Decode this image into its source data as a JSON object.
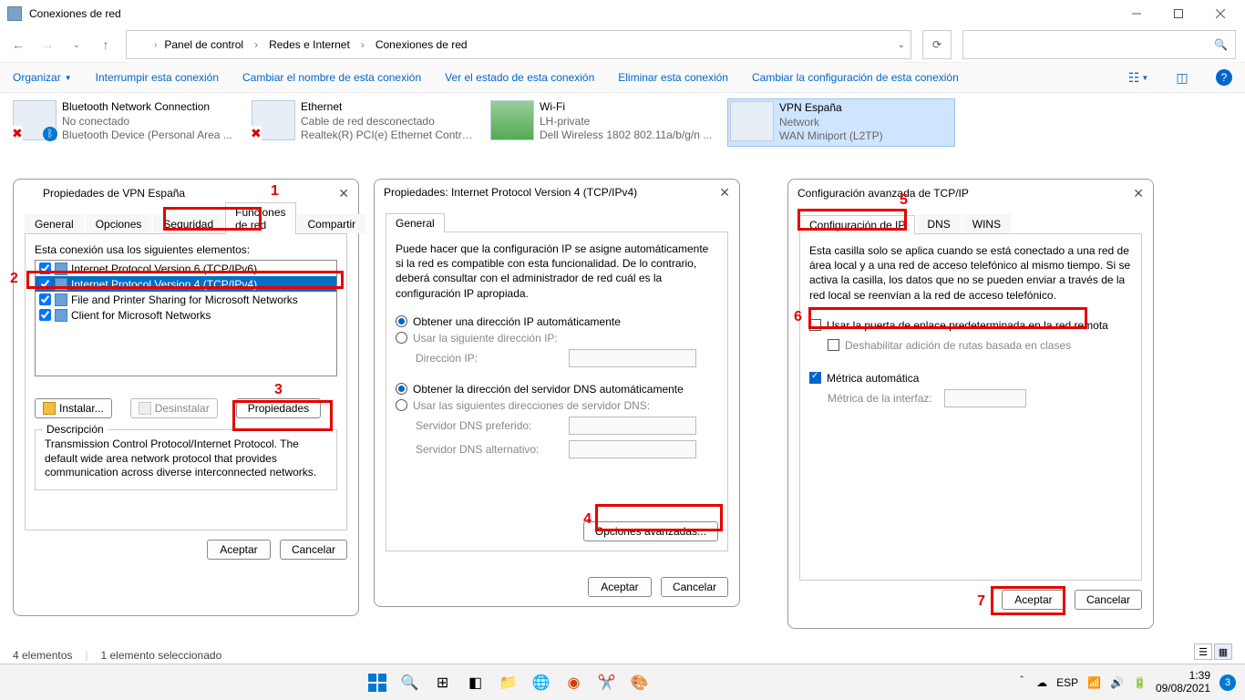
{
  "window": {
    "title": "Conexiones de red"
  },
  "breadcrumbs": {
    "c0": "Panel de control",
    "c1": "Redes e Internet",
    "c2": "Conexiones de red"
  },
  "cmdbar": {
    "organizar": "Organizar",
    "interrumpir": "Interrumpir esta conexión",
    "renombrar": "Cambiar el nombre de esta conexión",
    "ver_estado": "Ver el estado de esta conexión",
    "eliminar": "Eliminar esta conexión",
    "cambiar_config": "Cambiar la configuración de esta conexión"
  },
  "connections": [
    {
      "name": "Bluetooth Network Connection",
      "status": "No conectado",
      "device": "Bluetooth Device (Personal Area ..."
    },
    {
      "name": "Ethernet",
      "status": "Cable de red desconectado",
      "device": "Realtek(R) PCI(e) Ethernet Control..."
    },
    {
      "name": "Wi-Fi",
      "status": "LH-private",
      "device": "Dell Wireless 1802 802.11a/b/g/n ..."
    },
    {
      "name": "VPN España",
      "status": "Network",
      "device": "WAN Miniport (L2TP)"
    }
  ],
  "dlg1": {
    "title": "Propiedades de VPN España",
    "tabs": {
      "general": "General",
      "opciones": "Opciones",
      "seguridad": "Seguridad",
      "funciones": "Funciones de red",
      "compartir": "Compartir"
    },
    "label": "Esta conexión usa los siguientes elementos:",
    "items": {
      "ipv6": "Internet Protocol Version 6 (TCP/IPv6)",
      "ipv4": "Internet Protocol Version 4 (TCP/IPv4)",
      "fileprint": "File and Printer Sharing for Microsoft Networks",
      "client": "Client for Microsoft Networks"
    },
    "btn_instalar": "Instalar...",
    "btn_desinstalar": "Desinstalar",
    "btn_propiedades": "Propiedades",
    "desc_label": "Descripción",
    "desc": "Transmission Control Protocol/Internet Protocol. The default wide area network protocol that provides communication across diverse interconnected networks.",
    "aceptar": "Aceptar",
    "cancelar": "Cancelar"
  },
  "dlg2": {
    "title": "Propiedades: Internet Protocol Version 4 (TCP/IPv4)",
    "tab_general": "General",
    "intro": "Puede hacer que la configuración IP se asigne automáticamente si la red es compatible con esta funcionalidad. De lo contrario, deberá consultar con el administrador de red cuál es la configuración IP apropiada.",
    "r_auto_ip": "Obtener una dirección IP automáticamente",
    "r_manual_ip": "Usar la siguiente dirección IP:",
    "lbl_ip": "Dirección IP:",
    "r_auto_dns": "Obtener la dirección del servidor DNS automáticamente",
    "r_manual_dns": "Usar las siguientes direcciones de servidor DNS:",
    "lbl_dns1": "Servidor DNS preferido:",
    "lbl_dns2": "Servidor DNS alternativo:",
    "btn_avanzadas": "Opciones avanzadas...",
    "aceptar": "Aceptar",
    "cancelar": "Cancelar"
  },
  "dlg3": {
    "title": "Configuración avanzada de TCP/IP",
    "tabs": {
      "ip": "Configuración de IP",
      "dns": "DNS",
      "wins": "WINS"
    },
    "intro": "Esta casilla solo se aplica cuando se está conectado a una red de área local y a una red de acceso telefónico al mismo tiempo. Si se activa la casilla, los datos que no se pueden enviar a través de la red local se reenvían a la red de acceso telefónico.",
    "chk_gateway": "Usar la puerta de enlace predeterminada en la red remota",
    "chk_rutas": "Deshabilitar adición de rutas basada en clases",
    "chk_metrica": "Métrica automática",
    "lbl_metrica": "Métrica de la interfaz:",
    "aceptar": "Aceptar",
    "cancelar": "Cancelar"
  },
  "status": {
    "items": "4 elementos",
    "sel": "1 elemento seleccionado"
  },
  "systray": {
    "lang": "ESP"
  },
  "clock": {
    "time": "1:39",
    "date": "09/08/2021"
  },
  "notif_count": "3",
  "ann": {
    "n1": "1",
    "n2": "2",
    "n3": "3",
    "n4": "4",
    "n5": "5",
    "n6": "6",
    "n7": "7"
  }
}
